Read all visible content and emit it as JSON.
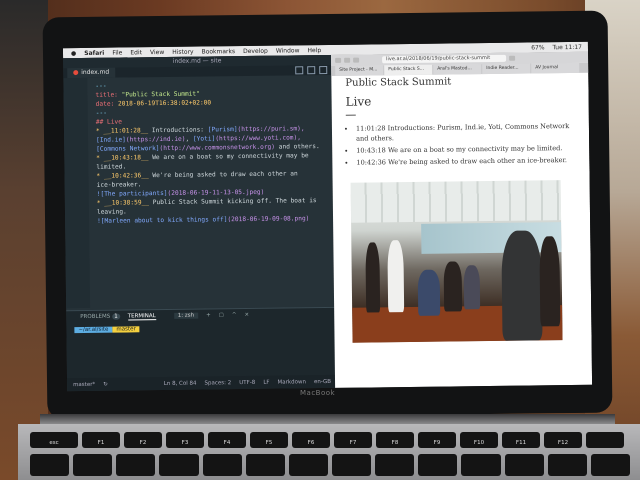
{
  "menubar": {
    "app": "Safari",
    "items": [
      "File",
      "Edit",
      "View",
      "History",
      "Bookmarks",
      "Develop",
      "Window",
      "Help"
    ],
    "status": [
      "67%",
      "Tue 11:17"
    ]
  },
  "editor": {
    "window_title": "index.md — site",
    "tab": "index.md",
    "lines": [
      {
        "parts": [
          {
            "t": "---",
            "c": "c-cyan"
          }
        ]
      },
      {
        "parts": [
          {
            "t": "title: ",
            "c": "c-red"
          },
          {
            "t": "\"Public Stack Summit\"",
            "c": "c-grn"
          }
        ]
      },
      {
        "parts": [
          {
            "t": "date: ",
            "c": "c-red"
          },
          {
            "t": "2018-06-19T16:38:02+02:00",
            "c": "c-yel"
          }
        ]
      },
      {
        "parts": [
          {
            "t": "---",
            "c": "c-cyan"
          }
        ]
      },
      {
        "parts": [
          {
            "t": "",
            "c": ""
          }
        ]
      },
      {
        "parts": [
          {
            "t": "## Live",
            "c": "c-red"
          }
        ]
      },
      {
        "parts": [
          {
            "t": "",
            "c": ""
          }
        ]
      },
      {
        "parts": [
          {
            "t": "* __11:01:28__ ",
            "c": "c-yel"
          },
          {
            "t": "Introductions: ",
            "c": ""
          },
          {
            "t": "[Purism]",
            "c": "c-blu"
          },
          {
            "t": "(https://puri.sm),",
            "c": "c-pur"
          }
        ]
      },
      {
        "parts": [
          {
            "t": "[Ind.ie]",
            "c": "c-blu"
          },
          {
            "t": "(https://ind.ie)",
            "c": "c-pur"
          },
          {
            "t": ", ",
            "c": ""
          },
          {
            "t": "[Yoti]",
            "c": "c-blu"
          },
          {
            "t": "(https://www.yoti.com),",
            "c": "c-pur"
          }
        ]
      },
      {
        "parts": [
          {
            "t": "[Commons Network]",
            "c": "c-blu"
          },
          {
            "t": "(http://www.commonsnetwork.org)",
            "c": "c-pur"
          },
          {
            "t": " and others.",
            "c": ""
          }
        ]
      },
      {
        "parts": [
          {
            "t": "* __10:43:18__ ",
            "c": "c-yel"
          },
          {
            "t": "We are on a boat so my connectivity may be",
            "c": ""
          }
        ]
      },
      {
        "parts": [
          {
            "t": "limited.",
            "c": ""
          }
        ]
      },
      {
        "parts": [
          {
            "t": "* __10:42:36__ ",
            "c": "c-yel"
          },
          {
            "t": "We're being asked to draw each other an",
            "c": ""
          }
        ]
      },
      {
        "parts": [
          {
            "t": "ice-breaker.",
            "c": ""
          }
        ]
      },
      {
        "parts": [
          {
            "t": "",
            "c": ""
          }
        ]
      },
      {
        "parts": [
          {
            "t": "![The participants]",
            "c": "c-blu"
          },
          {
            "t": "(2018-06-19-11-13-05.jpeg)",
            "c": "c-pur"
          }
        ]
      },
      {
        "parts": [
          {
            "t": "",
            "c": ""
          }
        ]
      },
      {
        "parts": [
          {
            "t": "* __10:38:59__ ",
            "c": "c-yel"
          },
          {
            "t": "Public Stack Summit kicking off. The boat is",
            "c": ""
          }
        ]
      },
      {
        "parts": [
          {
            "t": "leaving.",
            "c": ""
          }
        ]
      },
      {
        "parts": [
          {
            "t": "",
            "c": ""
          }
        ]
      },
      {
        "parts": [
          {
            "t": "![Marleen about to kick things off]",
            "c": "c-blu"
          },
          {
            "t": "(2018-06-19-09-08.png)",
            "c": "c-pur"
          }
        ]
      }
    ],
    "panel": {
      "problems_label": "PROBLEMS",
      "problems_count": "1",
      "terminal_label": "TERMINAL",
      "terminal_select": "1: zsh",
      "prompt_user": "~/ar.al/site",
      "prompt_branch": "master"
    },
    "status": {
      "branch": "master*",
      "position": "Ln 8, Col 84",
      "spaces": "Spaces: 2",
      "encoding": "UTF-8",
      "eol": "LF",
      "language": "Markdown",
      "locale": "en-GB"
    }
  },
  "browser": {
    "url": "live.ar.al/2018/06/19/public-stack-summit",
    "tabs": [
      "Site Project - M...",
      "Public Stack S...",
      "Aral's Mastod...",
      "Indie Reader...",
      "AV Journal"
    ],
    "page": {
      "title": "Public Stack Summit",
      "section": "Live",
      "items": [
        "11:01:28 Introductions: Purism, Ind.ie, Yoti, Commons Network and others.",
        "10:43:18 We are on a boat so my connectivity may be limited.",
        "10:42:36 We're being asked to draw each other an ice-breaker."
      ],
      "image_alt": "The participants"
    }
  },
  "laptop": {
    "brand": "MacBook",
    "function_keys": [
      "esc",
      "F1",
      "F2",
      "F3",
      "F4",
      "F5",
      "F6",
      "F7",
      "F8",
      "F9",
      "F10",
      "F11",
      "F12",
      ""
    ]
  }
}
